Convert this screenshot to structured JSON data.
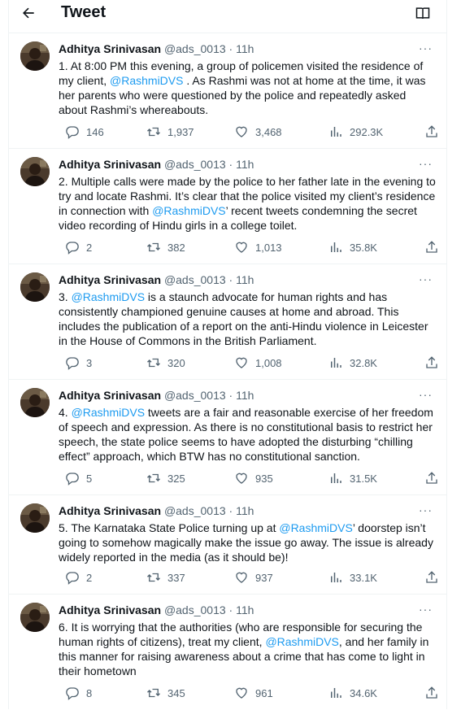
{
  "header": {
    "title": "Tweet"
  },
  "author": {
    "name": "Adhitya Srinivasan",
    "handle": "@ads_0013",
    "sep": "·",
    "time": "11h"
  },
  "more_label": "···",
  "tweets": [
    {
      "t1": "1. At 8:00 PM this evening, a group of policemen visited the residence of my client, ",
      "m1": "@RashmiDVS",
      "t2": " . As Rashmi was not at home at the time, it was her parents who were questioned by the police and repeatedly asked about Rashmi’s whereabouts.",
      "m2": "",
      "t3": "",
      "replies": "146",
      "retweets": "1,937",
      "likes": "3,468",
      "views": "292.3K"
    },
    {
      "t1": "2. Multiple calls were made by the police to her father late in the evening to try and locate Rashmi. It’s clear that the police visited my client’s residence in connection with ",
      "m1": "@RashmiDVS",
      "t2": "’ recent tweets condemning the secret video recording of Hindu girls in a college toilet.",
      "m2": "",
      "t3": "",
      "replies": "2",
      "retweets": "382",
      "likes": "1,013",
      "views": "35.8K"
    },
    {
      "t1": "3. ",
      "m1": "@RashmiDVS",
      "t2": " is a staunch advocate for human rights and has consistently championed genuine causes at home and abroad. This includes the publication of a report on the anti-Hindu violence in Leicester in the House of Commons in the British Parliament.",
      "m2": "",
      "t3": "",
      "replies": "3",
      "retweets": "320",
      "likes": "1,008",
      "views": "32.8K"
    },
    {
      "t1": "4. ",
      "m1": "@RashmiDVS",
      "t2": " tweets are a fair and reasonable exercise of her freedom of speech and expression. As there is no constitutional basis to restrict her speech, the state police seems to have adopted the disturbing “chilling effect” approach, which BTW has no constitutional sanction.",
      "m2": "",
      "t3": "",
      "replies": "5",
      "retweets": "325",
      "likes": "935",
      "views": "31.5K"
    },
    {
      "t1": "5. The Karnataka State Police turning up at ",
      "m1": "@RashmiDVS",
      "t2": "’ doorstep isn’t going to somehow magically make the issue go away. The issue is already widely reported in the media (as it should be)!",
      "m2": "",
      "t3": "",
      "replies": "2",
      "retweets": "337",
      "likes": "937",
      "views": "33.1K"
    },
    {
      "t1": "6. It is worrying that the authorities (who are responsible for securing the human rights of citizens), treat my client, ",
      "m1": "@RashmiDVS",
      "t2": ", and her family in this manner for raising awareness about a crime that has come to light in their hometown",
      "m2": "",
      "t3": "",
      "replies": "8",
      "retweets": "345",
      "likes": "961",
      "views": "34.6K"
    }
  ]
}
